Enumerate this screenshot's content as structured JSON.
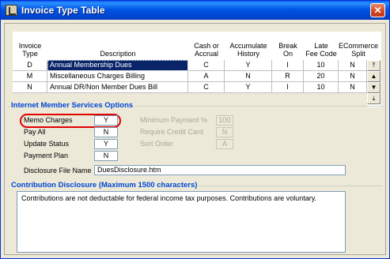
{
  "window": {
    "title": "Invoice Type Table",
    "close_glyph": "✕"
  },
  "grid": {
    "columns": [
      "Invoice\nType",
      "Description",
      "Cash or\nAccrual",
      "Accumulate\nHistory",
      "Break\nOn",
      "Late\nFee Code",
      "ECommerce\nSplit"
    ],
    "rows": [
      {
        "type": "D",
        "description": "Annual Membership Dues",
        "cash_accrual": "C",
        "accumulate": "Y",
        "break_on": "I",
        "late_fee": "10",
        "ecommerce": "N"
      },
      {
        "type": "M",
        "description": "Miscellaneous Charges Billing",
        "cash_accrual": "A",
        "accumulate": "N",
        "break_on": "R",
        "late_fee": "20",
        "ecommerce": "N"
      },
      {
        "type": "N",
        "description": "Annual DR/Non Member Dues Bill",
        "cash_accrual": "C",
        "accumulate": "Y",
        "break_on": "I",
        "late_fee": "10",
        "ecommerce": "N"
      }
    ],
    "scroll_icons": {
      "top": "⤒",
      "up": "▲",
      "down": "▼",
      "bottom": "⤓"
    }
  },
  "ims": {
    "title": "Internet Member Services Options",
    "memo_charges_label": "Memo Charges",
    "memo_charges": "Y",
    "pay_all_label": "Pay All",
    "pay_all": "N",
    "update_status_label": "Update Status",
    "update_status": "Y",
    "payment_plan_label": "Payment Plan",
    "payment_plan": "N",
    "min_payment_label": "Minimum Payment %",
    "min_payment": "100",
    "require_cc_label": "Require Credit Card",
    "require_cc": "N",
    "sort_order_label": "Sort Order",
    "sort_order": "A",
    "disclosure_file_label": "Disclosure File Name",
    "disclosure_file": "DuesDisclosure.htm"
  },
  "contribution": {
    "title": "Contribution Disclosure (Maximum 1500 characters)",
    "text": "Contributions are not deductable for federal income tax purposes. Contributions are voluntary."
  },
  "colors": {
    "highlight": "#e00000",
    "group_title": "#0046d5",
    "selection": "#0a246a"
  }
}
